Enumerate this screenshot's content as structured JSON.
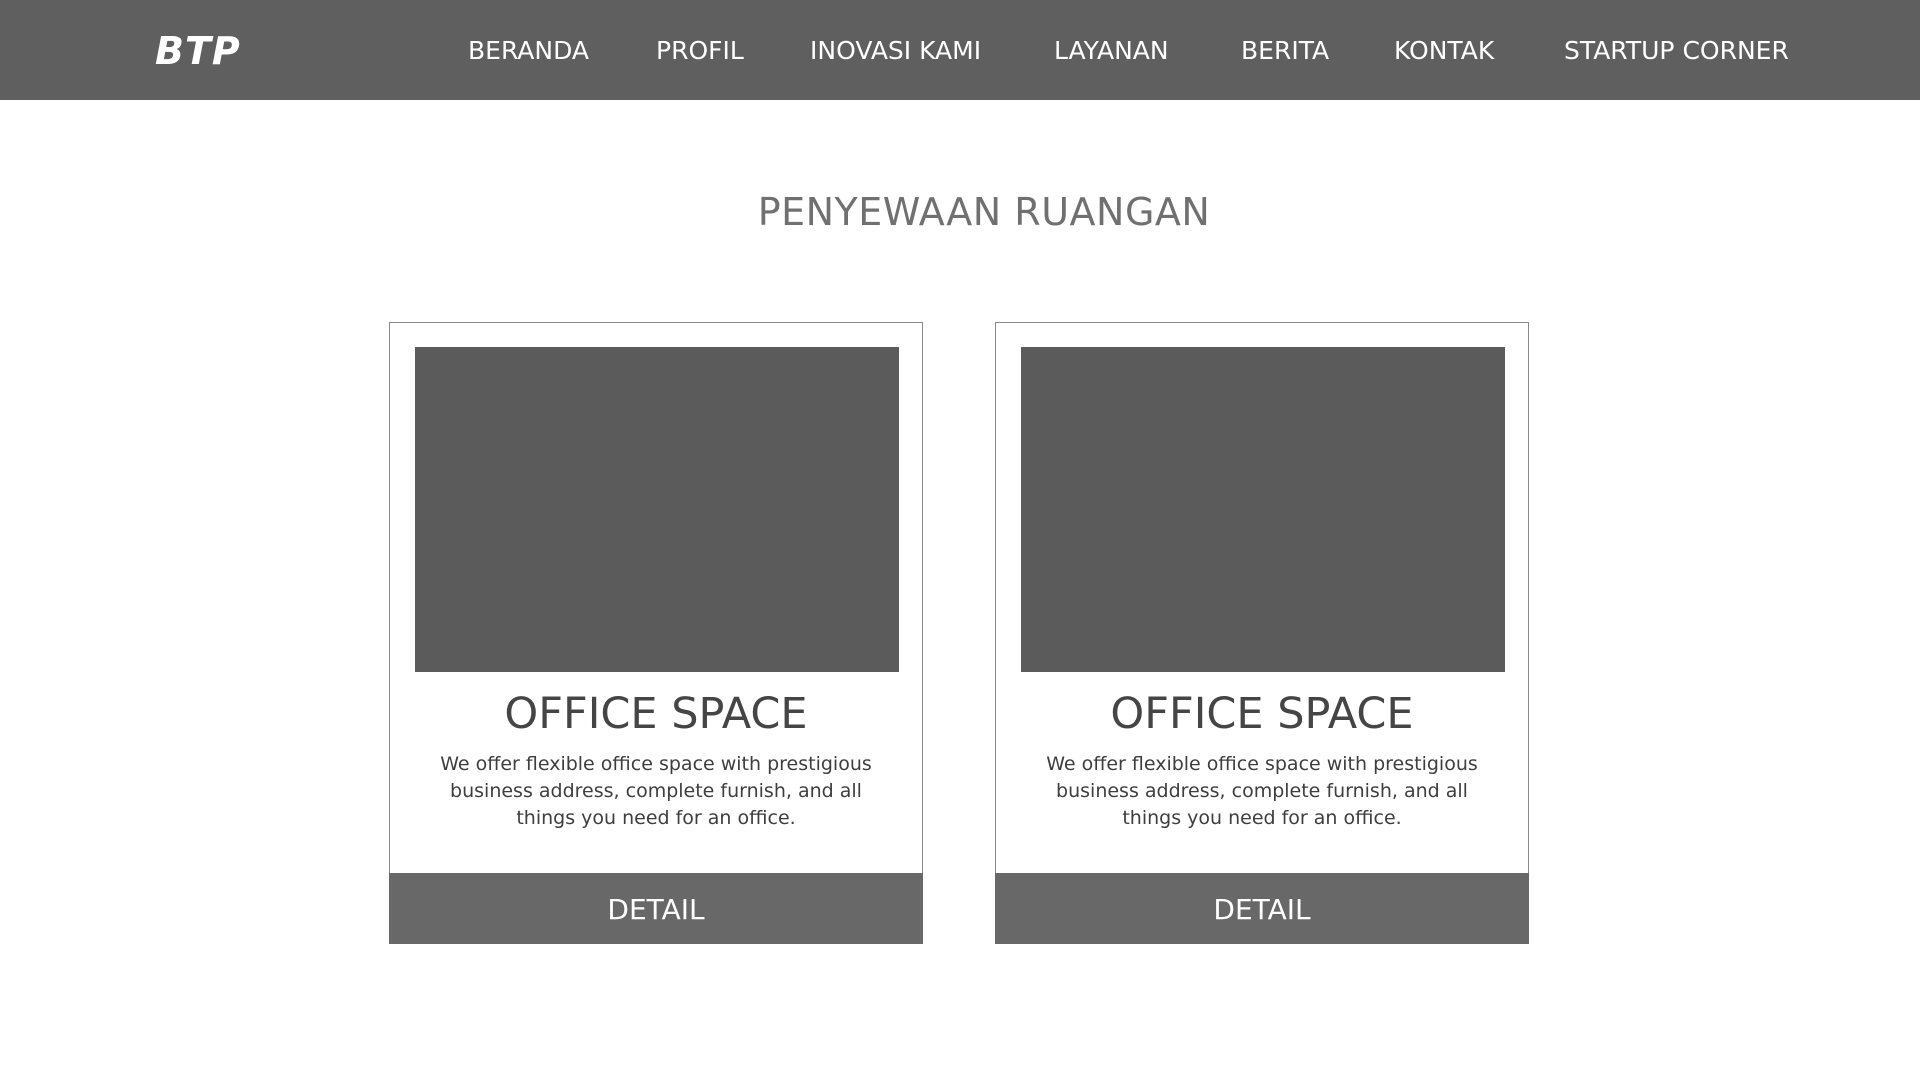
{
  "header": {
    "logo": "BTP",
    "nav": [
      {
        "label": "BERANDA"
      },
      {
        "label": "PROFIL"
      },
      {
        "label": "INOVASI KAMI"
      },
      {
        "label": "LAYANAN"
      },
      {
        "label": "BERITA"
      },
      {
        "label": "KONTAK"
      },
      {
        "label": "STARTUP CORNER"
      }
    ]
  },
  "main": {
    "title": "PENYEWAAN RUANGAN",
    "cards": [
      {
        "title": "OFFICE SPACE",
        "description": "We offer flexible office space with prestigious business address, complete furnish, and all things you need for an office.",
        "button_label": "DETAIL"
      },
      {
        "title": "OFFICE SPACE",
        "description": "We offer flexible office space with prestigious business address, complete furnish, and all things you need for an office.",
        "button_label": "DETAIL"
      }
    ]
  },
  "colors": {
    "navbar_bg": "#5f5f5f",
    "image_placeholder": "#5b5b5b",
    "button_bg": "#686868",
    "title_text": "#707070"
  }
}
